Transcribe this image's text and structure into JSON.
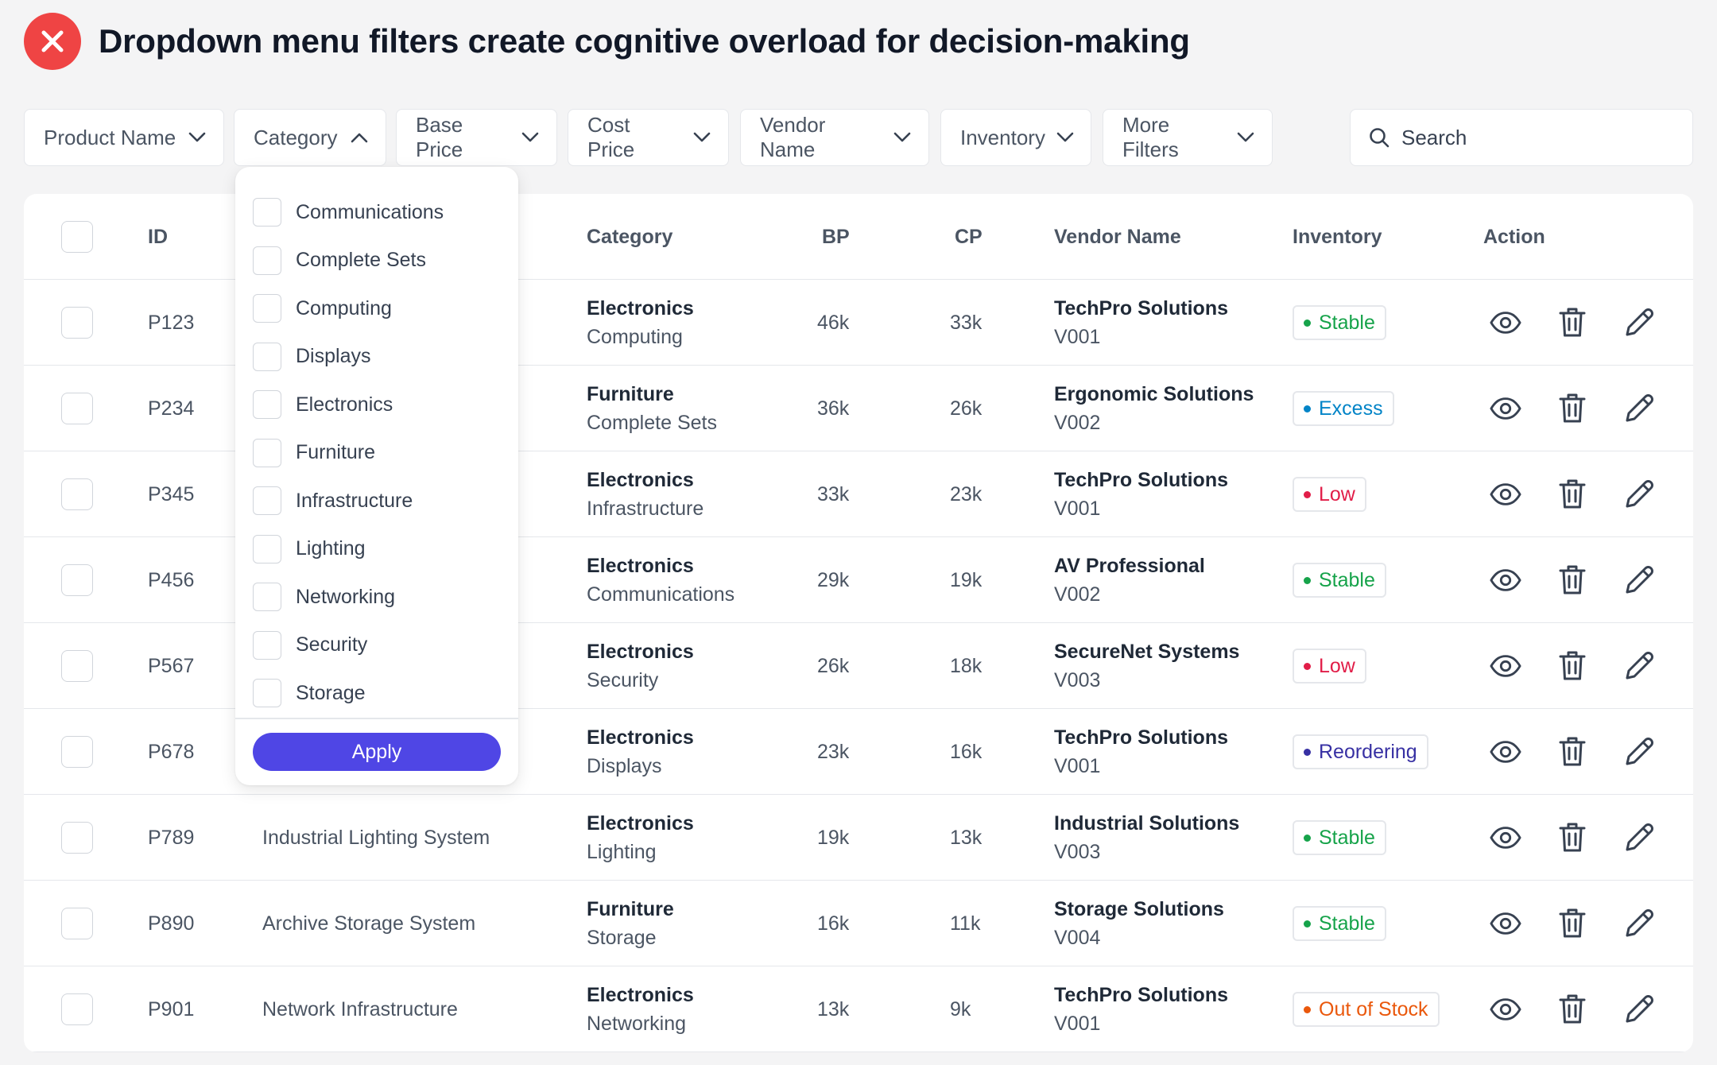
{
  "header": {
    "title": "Dropdown menu filters create cognitive overload for decision-making"
  },
  "filters": [
    {
      "label": "Product Name",
      "open": false
    },
    {
      "label": "Category",
      "open": true
    },
    {
      "label": "Base Price",
      "open": false
    },
    {
      "label": "Cost Price",
      "open": false
    },
    {
      "label": "Vendor Name",
      "open": false
    },
    {
      "label": "Inventory",
      "open": false
    },
    {
      "label": "More Filters",
      "open": false
    }
  ],
  "search": {
    "placeholder": "Search"
  },
  "dropdown": {
    "options": [
      "Communications",
      "Complete Sets",
      "Computing",
      "Displays",
      "Electronics",
      "Furniture",
      "Infrastructure",
      "Lighting",
      "Networking",
      "Security",
      "Storage"
    ],
    "apply_label": "Apply"
  },
  "table": {
    "columns": {
      "id": "ID",
      "category": "Category",
      "bp": "BP",
      "cp": "CP",
      "vendor": "Vendor Name",
      "inventory": "Inventory",
      "action": "Action"
    },
    "rows": [
      {
        "id": "P123",
        "name": "",
        "category": "Electronics",
        "subcategory": "Computing",
        "bp": "46k",
        "cp": "33k",
        "vendor": "TechPro Solutions",
        "vendor_id": "V001",
        "status": "Stable"
      },
      {
        "id": "P234",
        "name": "",
        "category": "Furniture",
        "subcategory": "Complete Sets",
        "bp": "36k",
        "cp": "26k",
        "vendor": "Ergonomic Solutions",
        "vendor_id": "V002",
        "status": "Excess"
      },
      {
        "id": "P345",
        "name": "",
        "category": "Electronics",
        "subcategory": "Infrastructure",
        "bp": "33k",
        "cp": "23k",
        "vendor": "TechPro Solutions",
        "vendor_id": "V001",
        "status": "Low"
      },
      {
        "id": "P456",
        "name": "",
        "category": "Electronics",
        "subcategory": "Communications",
        "bp": "29k",
        "cp": "19k",
        "vendor": "AV Professional",
        "vendor_id": "V002",
        "status": "Stable"
      },
      {
        "id": "P567",
        "name": "",
        "category": "Electronics",
        "subcategory": "Security",
        "bp": "26k",
        "cp": "18k",
        "vendor": "SecureNet Systems",
        "vendor_id": "V003",
        "status": "Low"
      },
      {
        "id": "P678",
        "name": "",
        "category": "Electronics",
        "subcategory": "Displays",
        "bp": "23k",
        "cp": "16k",
        "vendor": "TechPro Solutions",
        "vendor_id": "V001",
        "status": "Reordering"
      },
      {
        "id": "P789",
        "name": "Industrial Lighting System",
        "category": "Electronics",
        "subcategory": "Lighting",
        "bp": "19k",
        "cp": "13k",
        "vendor": "Industrial Solutions",
        "vendor_id": "V003",
        "status": "Stable"
      },
      {
        "id": "P890",
        "name": "Archive Storage System",
        "category": "Furniture",
        "subcategory": "Storage",
        "bp": "16k",
        "cp": "11k",
        "vendor": "Storage Solutions",
        "vendor_id": "V004",
        "status": "Stable"
      },
      {
        "id": "P901",
        "name": "Network Infrastructure",
        "category": "Electronics",
        "subcategory": "Networking",
        "bp": "13k",
        "cp": "9k",
        "vendor": "TechPro Solutions",
        "vendor_id": "V001",
        "status": "Out of Stock"
      }
    ]
  },
  "status_colors": {
    "Stable": "#16a34a",
    "Excess": "#0284c7",
    "Low": "#e11d48",
    "Reordering": "#3730a3",
    "Out of Stock": "#ea580c"
  },
  "icons": {
    "header": "close-icon",
    "actions": [
      "eye-icon",
      "trash-icon",
      "pencil-icon"
    ]
  },
  "colors": {
    "danger": "#ef4444",
    "accent": "#4f46e5"
  }
}
